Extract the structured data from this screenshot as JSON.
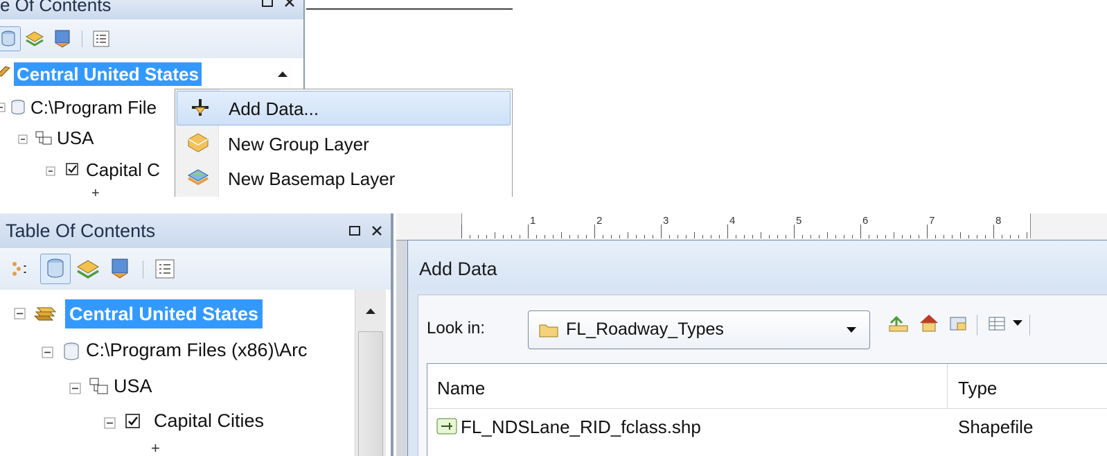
{
  "top": {
    "toc_title": "e Of Contents",
    "tree": {
      "root_label": "Central United States",
      "path_label": "C:\\Program File",
      "group_label": "USA",
      "layer_label": "Capital C"
    },
    "context_menu": {
      "items": [
        {
          "label": "Add Data...",
          "icon": "add-data-icon",
          "highlighted": true
        },
        {
          "label": "New Group Layer",
          "icon": "group-layer-icon",
          "highlighted": false
        },
        {
          "label": "New Basemap Layer",
          "icon": "basemap-layer-icon",
          "highlighted": false
        }
      ]
    }
  },
  "bottom": {
    "toc_title": "Table Of Contents",
    "tree": {
      "root_label": "Central United States",
      "path_label": "C:\\Program Files (x86)\\Arc",
      "group_label": "USA",
      "layer_label": "Capital Cities"
    },
    "ruler": {
      "numbers": [
        "1",
        "2",
        "3",
        "4",
        "5",
        "6",
        "7",
        "8"
      ]
    },
    "add_data_dialog": {
      "title": "Add Data",
      "look_in_label": "Look in:",
      "look_in_value": "FL_Roadway_Types",
      "columns": [
        "Name",
        "Type"
      ],
      "rows": [
        {
          "name": "FL_NDSLane_RID_fclass.shp",
          "type": "Shapefile"
        }
      ]
    }
  },
  "colors": {
    "selection": "#3399ff",
    "titlebar": "#cad9ee",
    "menu_hover": "#cfe0f7"
  }
}
